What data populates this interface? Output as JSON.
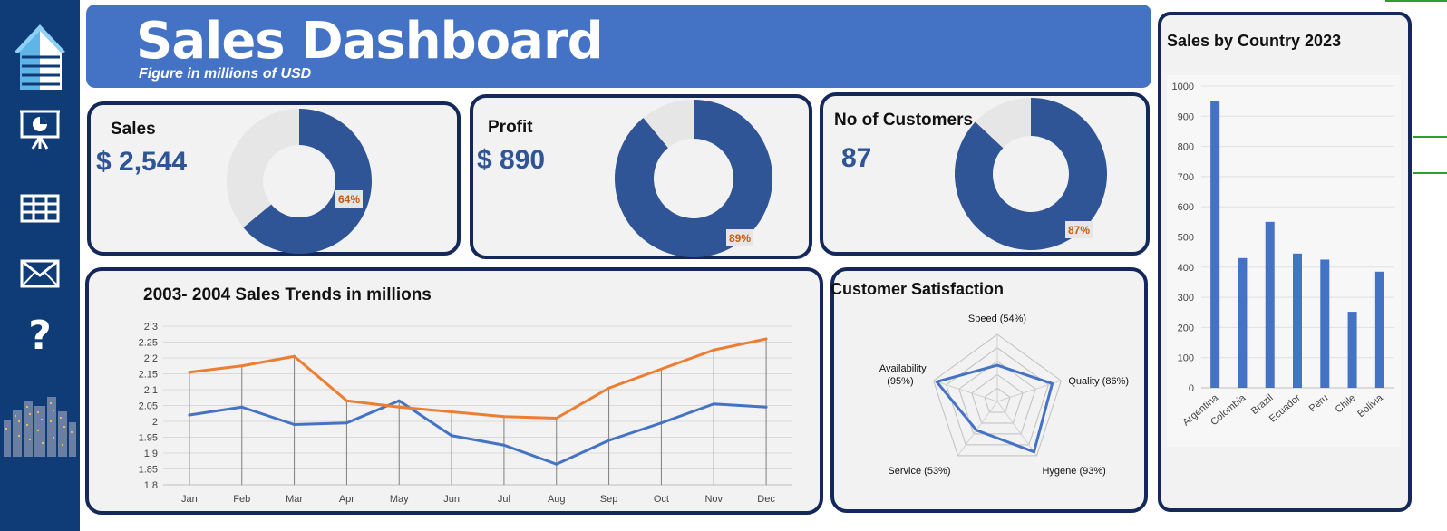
{
  "header": {
    "title": "Sales Dashboard",
    "subtitle": "Figure in millions of USD"
  },
  "sidebar": {
    "icons": [
      "building-logo-icon",
      "presentation-icon",
      "table-icon",
      "mail-icon",
      "help-icon",
      "city-skyline-icon"
    ],
    "help_glyph": "?"
  },
  "kpis": {
    "sales": {
      "title": "Sales",
      "value": "$ 2,544",
      "percent": 64,
      "percent_label": "64%"
    },
    "profit": {
      "title": "Profit",
      "value": "$ 890",
      "percent": 89,
      "percent_label": "89%"
    },
    "customers": {
      "title": "No of Customers",
      "value": "87",
      "percent": 87,
      "percent_label": "87%"
    }
  },
  "colors": {
    "primary": "#2f5597",
    "header": "#4472c4",
    "line_2003": "#4472c4",
    "line_2004": "#ed7d31",
    "donut_rest": "#e7e6e6",
    "border": "#15285a",
    "sidebar": "#0f3b76",
    "label_orange": "#c55a11"
  },
  "chart_data": [
    {
      "type": "line",
      "title": "2003- 2004 Sales Trends in millions",
      "categories": [
        "Jan",
        "Feb",
        "Mar",
        "Apr",
        "May",
        "Jun",
        "Jul",
        "Aug",
        "Sep",
        "Oct",
        "Nov",
        "Dec"
      ],
      "series": [
        {
          "values": [
            2.02,
            2.045,
            1.99,
            1.995,
            2.065,
            1.955,
            1.925,
            1.865,
            1.94,
            1.995,
            2.055,
            2.045
          ]
        },
        {
          "values": [
            2.155,
            2.175,
            2.205,
            2.065,
            2.045,
            2.03,
            2.015,
            2.01,
            2.105,
            2.165,
            2.225,
            2.26
          ]
        }
      ],
      "ylim": [
        1.8,
        2.3
      ],
      "yticks": [
        "1.8",
        "1.85",
        "1.9",
        "1.95",
        "2",
        "2.05",
        "2.1",
        "2.15",
        "2.2",
        "2.25",
        "2.3"
      ],
      "grid": true,
      "drop_lines": true
    },
    {
      "type": "radar",
      "title": "Customer Satisfaction",
      "axes": [
        {
          "label": "Speed (54%)",
          "value": 54
        },
        {
          "label": "Quality (86%)",
          "value": 86
        },
        {
          "label": "Hygene (93%)",
          "value": 93
        },
        {
          "label": "Service (53%)",
          "value": 53
        },
        {
          "label": "Availability",
          "label2": "(95%)",
          "value": 95
        }
      ],
      "range": [
        0,
        100
      ]
    },
    {
      "type": "bar",
      "title": "Sales by Country 2023",
      "categories": [
        "Argentina",
        "Colombia",
        "Brazil",
        "Ecuador",
        "Peru",
        "Chile",
        "Bolivia"
      ],
      "values": [
        950,
        430,
        550,
        445,
        425,
        252,
        385
      ],
      "ylim": [
        0,
        1000
      ],
      "yticks": [
        "0",
        "100",
        "200",
        "300",
        "400",
        "500",
        "600",
        "700",
        "800",
        "900",
        "1000"
      ],
      "grid": true
    }
  ]
}
